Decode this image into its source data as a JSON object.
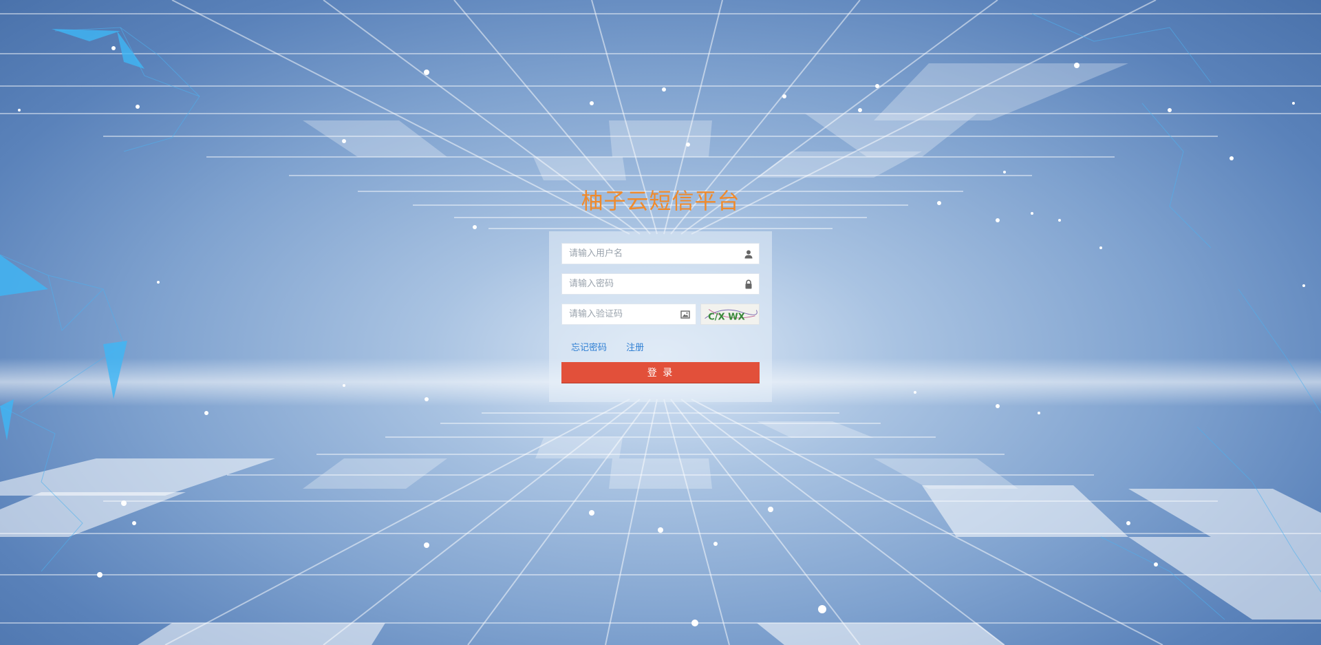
{
  "page": {
    "title": "柚子云短信平台"
  },
  "login_form": {
    "username_placeholder": "请输入用户名",
    "password_placeholder": "请输入密码",
    "captcha_placeholder": "请输入验证码",
    "captcha_text": "C/X WX",
    "forgot_password_label": "忘记密码",
    "register_label": "注册",
    "login_button_label": "登 录"
  },
  "icons": {
    "username": "user-icon",
    "password": "lock-icon",
    "captcha": "image-icon"
  },
  "colors": {
    "title": "#ef8a2c",
    "login_button": "#e2503a",
    "link": "#2f7fd3",
    "background": "#7fa2cf"
  }
}
